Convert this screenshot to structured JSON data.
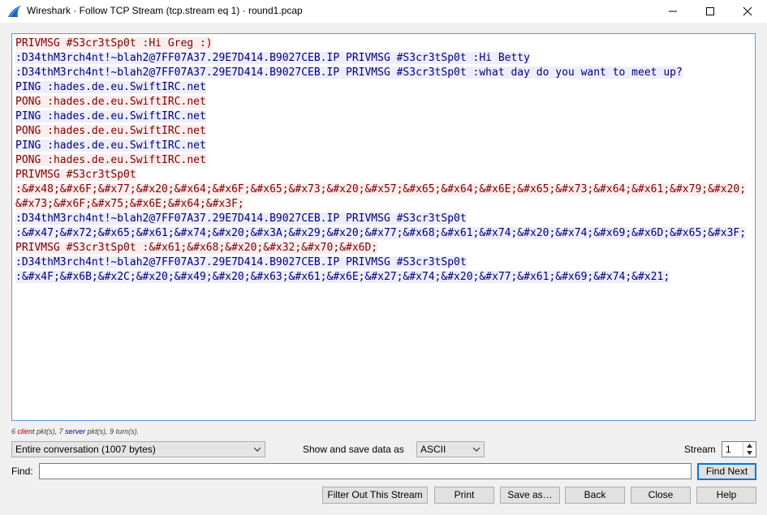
{
  "window": {
    "title": "Wireshark · Follow TCP Stream (tcp.stream eq 1) · round1.pcap",
    "brand_color": "#1565c0"
  },
  "stream_lines": [
    {
      "dir": "client",
      "text": "PRIVMSG #S3cr3tSp0t :Hi Greg :)"
    },
    {
      "dir": "server",
      "text": ":D34thM3rch4nt!~blah2@7FF07A37.29E7D414.B9027CEB.IP PRIVMSG #S3cr3tSp0t :Hi Betty"
    },
    {
      "dir": "server",
      "text": ":D34thM3rch4nt!~blah2@7FF07A37.29E7D414.B9027CEB.IP PRIVMSG #S3cr3tSp0t :what day do you want to meet up?"
    },
    {
      "dir": "server",
      "text": "PING :hades.de.eu.SwiftIRC.net"
    },
    {
      "dir": "client",
      "text": "PONG :hades.de.eu.SwiftIRC.net"
    },
    {
      "dir": "server",
      "text": "PING :hades.de.eu.SwiftIRC.net"
    },
    {
      "dir": "client",
      "text": "PONG :hades.de.eu.SwiftIRC.net"
    },
    {
      "dir": "server",
      "text": "PING :hades.de.eu.SwiftIRC.net"
    },
    {
      "dir": "client",
      "text": "PONG :hades.de.eu.SwiftIRC.net"
    },
    {
      "dir": "client",
      "text": "PRIVMSG #S3cr3tSp0t"
    },
    {
      "dir": "client",
      "text": ":&#x48;&#x6F;&#x77;&#x20;&#x64;&#x6F;&#x65;&#x73;&#x20;&#x57;&#x65;&#x64;&#x6E;&#x65;&#x73;&#x64;&#x61;&#x79;&#x20;&#x73;&#x6F;&#x75;&#x6E;&#x64;&#x3F;"
    },
    {
      "dir": "server",
      "text": ":D34thM3rch4nt!~blah2@7FF07A37.29E7D414.B9027CEB.IP PRIVMSG #S3cr3tSp0t"
    },
    {
      "dir": "server",
      "text": ":&#x47;&#x72;&#x65;&#x61;&#x74;&#x20;&#x3A;&#x29;&#x20;&#x77;&#x68;&#x61;&#x74;&#x20;&#x74;&#x69;&#x6D;&#x65;&#x3F;"
    },
    {
      "dir": "client",
      "text": "PRIVMSG #S3cr3tSp0t :&#x61;&#x68;&#x20;&#x32;&#x70;&#x6D;"
    },
    {
      "dir": "server",
      "text": ":D34thM3rch4nt!~blah2@7FF07A37.29E7D414.B9027CEB.IP PRIVMSG #S3cr3tSp0t"
    },
    {
      "dir": "server",
      "text": ":&#x4F;&#x6B;&#x2C;&#x20;&#x49;&#x20;&#x63;&#x61;&#x6E;&#x27;&#x74;&#x20;&#x77;&#x61;&#x69;&#x74;&#x21;"
    }
  ],
  "stats": {
    "client_count": "6",
    "client_label": "client",
    "suffix1": "pkt(s),",
    "server_count": "7",
    "server_label": "server",
    "suffix2": "pkt(s), 9 turn(s)."
  },
  "controls": {
    "conversation_select": "Entire conversation (1007 bytes)",
    "show_as_label": "Show and save data as",
    "show_as_value": "ASCII",
    "stream_label": "Stream",
    "stream_value": "1",
    "find_label": "Find:",
    "find_value": "",
    "find_next": "Find Next"
  },
  "buttons": {
    "filter_out": "Filter Out This Stream",
    "print": "Print",
    "save_as": "Save as…",
    "back": "Back",
    "close": "Close",
    "help": "Help"
  },
  "colors": {
    "client_text": "#7f0000",
    "client_bg": "#fbeded",
    "server_text": "#00007f",
    "server_bg": "#ededfb",
    "focus_border": "#0078d7"
  }
}
